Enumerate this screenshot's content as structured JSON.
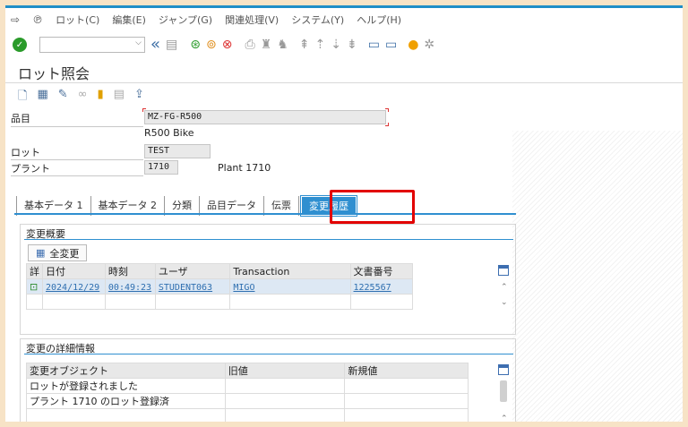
{
  "menubar": {
    "items": [
      "ロット(C)",
      "編集(E)",
      "ジャンプ(G)",
      "関連処理(V)",
      "システム(Y)",
      "ヘルプ(H)"
    ]
  },
  "toolbar": {
    "command_field_value": "",
    "icons": [
      "ok-icon",
      "back-icon",
      "save-icon",
      "back-arrow-icon",
      "exit-icon",
      "cancel-icon",
      "print-icon",
      "find-icon",
      "find-next-icon",
      "first-page-icon",
      "prev-page-icon",
      "next-page-icon",
      "last-page-icon",
      "new-session-icon",
      "shortcut-icon",
      "help-icon",
      "settings-icon"
    ]
  },
  "page_title": "ロット照会",
  "app_toolbar": {
    "icons": [
      "new-doc-icon",
      "copy-icon",
      "edit-icon",
      "display-icon",
      "export-icon",
      "attachment-icon",
      "upload-icon"
    ]
  },
  "fields": {
    "material_label": "品目",
    "material_value": "MZ-FG-R500",
    "material_desc": "R500 Bike",
    "batch_label": "ロット",
    "batch_value": "TEST",
    "plant_label": "プラント",
    "plant_value": "1710",
    "plant_desc": "Plant 1710"
  },
  "tabs": [
    {
      "label": "基本データ 1"
    },
    {
      "label": "基本データ 2"
    },
    {
      "label": "分類"
    },
    {
      "label": "品目データ"
    },
    {
      "label": "伝票"
    },
    {
      "label": "変更履歴",
      "active": true
    }
  ],
  "overview": {
    "title": "変更概要",
    "all_changes_button": "全変更",
    "columns": [
      "詳",
      "日付",
      "時刻",
      "ユーザ",
      "Transaction",
      "文書番号"
    ],
    "rows": [
      {
        "date": "2024/12/29",
        "time": "00:49:23",
        "user": "STUDENT063",
        "transaction": "MIGO",
        "document": "1225567"
      }
    ]
  },
  "details": {
    "title": "変更の詳細情報",
    "columns": [
      "変更オブジェクト",
      "旧値",
      "新規値"
    ],
    "rows": [
      {
        "object": "ロットが登録されました",
        "old": "",
        "new": ""
      },
      {
        "object": "プラント 1710 のロット登録済",
        "old": "",
        "new": ""
      }
    ]
  },
  "colors": {
    "accent": "#2f8fd0",
    "highlight_box": "#e20000",
    "background": "#f7e3c6"
  }
}
